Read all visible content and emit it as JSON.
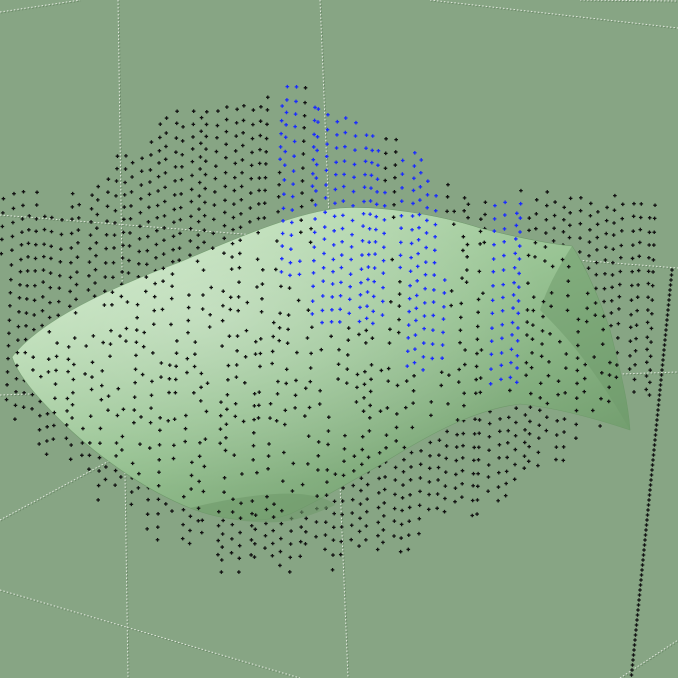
{
  "viewport": {
    "background_color": "#87a584",
    "grid_color": "#e2e8de",
    "grid_shadow_color": "#4e6a4c",
    "surface": {
      "color_light": "#bfe0b9",
      "color_mid": "#98c393",
      "color_dark": "#6f9a6b"
    },
    "point_colors": {
      "unselected": "#111111",
      "selected": "#1a2bff"
    }
  }
}
